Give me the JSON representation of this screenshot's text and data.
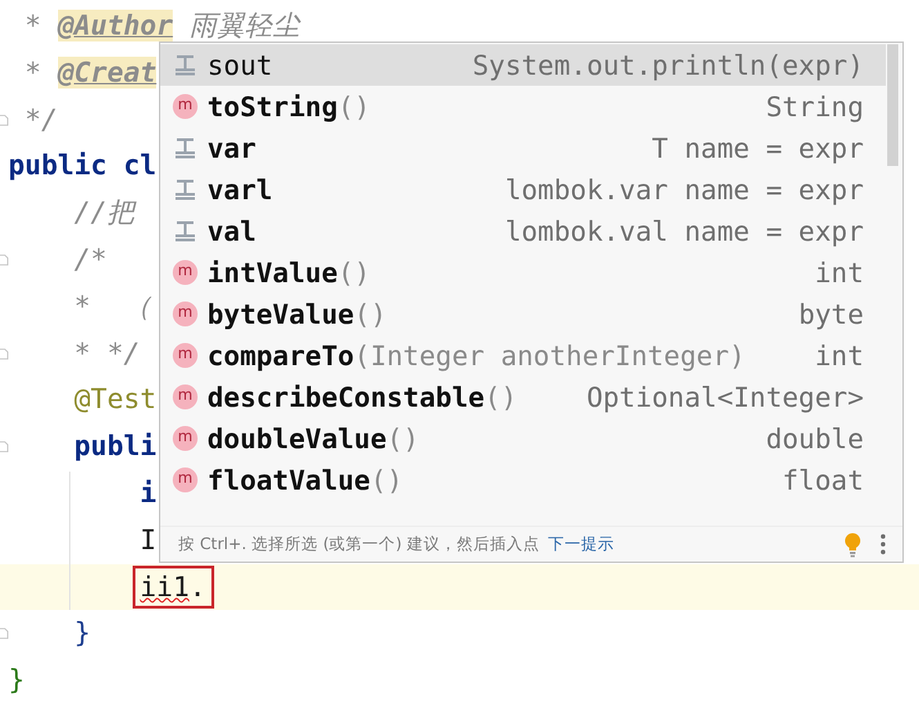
{
  "editor": {
    "lines": [
      {
        "fold": false,
        "current": false,
        "marked": false,
        "segments": [
          {
            "text": " * ",
            "kind": "comment"
          },
          {
            "text": "@Author",
            "kind": "doctag"
          },
          {
            "text": " 雨翼轻尘",
            "kind": "comment"
          }
        ]
      },
      {
        "fold": false,
        "current": false,
        "marked": false,
        "segments": [
          {
            "text": " * ",
            "kind": "comment"
          },
          {
            "text": "@Creat",
            "kind": "doctag"
          }
        ]
      },
      {
        "fold": true,
        "current": false,
        "marked": false,
        "segments": [
          {
            "text": " */",
            "kind": "comment"
          }
        ]
      },
      {
        "fold": false,
        "current": false,
        "marked": false,
        "segments": [
          {
            "text": "public cl",
            "kind": "keyword"
          }
        ]
      },
      {
        "fold": false,
        "current": false,
        "marked": false,
        "segments": [
          {
            "text": "    //把",
            "kind": "comment"
          }
        ]
      },
      {
        "fold": true,
        "current": false,
        "marked": false,
        "segments": [
          {
            "text": "    /*",
            "kind": "comment"
          }
        ]
      },
      {
        "fold": false,
        "current": false,
        "marked": false,
        "segments": [
          {
            "text": "    *  （",
            "kind": "comment"
          }
        ]
      },
      {
        "fold": true,
        "current": false,
        "marked": false,
        "segments": [
          {
            "text": "    * */",
            "kind": "comment"
          }
        ]
      },
      {
        "fold": false,
        "current": false,
        "marked": false,
        "segments": [
          {
            "text": "    @Test",
            "kind": "annotation"
          }
        ]
      },
      {
        "fold": true,
        "current": false,
        "marked": false,
        "segments": [
          {
            "text": "    publi",
            "kind": "keyword"
          }
        ]
      },
      {
        "fold": false,
        "current": false,
        "marked": false,
        "segments": [
          {
            "text": "        i",
            "kind": "keyword"
          }
        ]
      },
      {
        "fold": false,
        "current": false,
        "marked": false,
        "segments": [
          {
            "text": "        I",
            "kind": "code"
          }
        ]
      },
      {
        "fold": false,
        "current": true,
        "marked": true,
        "segments": [
          {
            "text": "ii1",
            "kind": "error"
          },
          {
            "text": ".",
            "kind": "code"
          }
        ]
      },
      {
        "fold": true,
        "current": false,
        "marked": false,
        "segments": [
          {
            "text": "    }",
            "kind": "brace"
          }
        ]
      },
      {
        "fold": false,
        "current": false,
        "marked": false,
        "segments": [
          {
            "text": "}",
            "kind": "outer_brace"
          }
        ]
      }
    ]
  },
  "completion": {
    "items": [
      {
        "kind": "template",
        "name": "sout",
        "type": "System.out.println(expr)",
        "selected": true
      },
      {
        "kind": "method",
        "badge": "m",
        "name": "toString",
        "params": "()",
        "type": "String",
        "selected": false
      },
      {
        "kind": "template",
        "name": "var",
        "type": "T name = expr",
        "selected": false
      },
      {
        "kind": "template",
        "name": "varl",
        "type": "lombok.var name = expr",
        "selected": false
      },
      {
        "kind": "template",
        "name": "val",
        "type": "lombok.val name = expr",
        "selected": false
      },
      {
        "kind": "method",
        "badge": "m",
        "name": "intValue",
        "params": "()",
        "type": "int",
        "selected": false
      },
      {
        "kind": "method",
        "badge": "m",
        "name": "byteValue",
        "params": "()",
        "type": "byte",
        "selected": false
      },
      {
        "kind": "method",
        "badge": "m",
        "name": "compareTo",
        "params": "(Integer anotherInteger)",
        "type": "int",
        "selected": false
      },
      {
        "kind": "method",
        "badge": "m",
        "name": "describeConstable",
        "params": "()",
        "type": "Optional<Integer>",
        "selected": false
      },
      {
        "kind": "method",
        "badge": "m",
        "name": "doubleValue",
        "params": "()",
        "type": "double",
        "selected": false
      },
      {
        "kind": "method",
        "badge": "m",
        "name": "floatValue",
        "params": "()",
        "type": "float",
        "selected": false
      }
    ],
    "footer": {
      "hint": "按 Ctrl+. 选择所选 (或第一个) 建议，然后插入点",
      "link": "下一提示"
    }
  }
}
